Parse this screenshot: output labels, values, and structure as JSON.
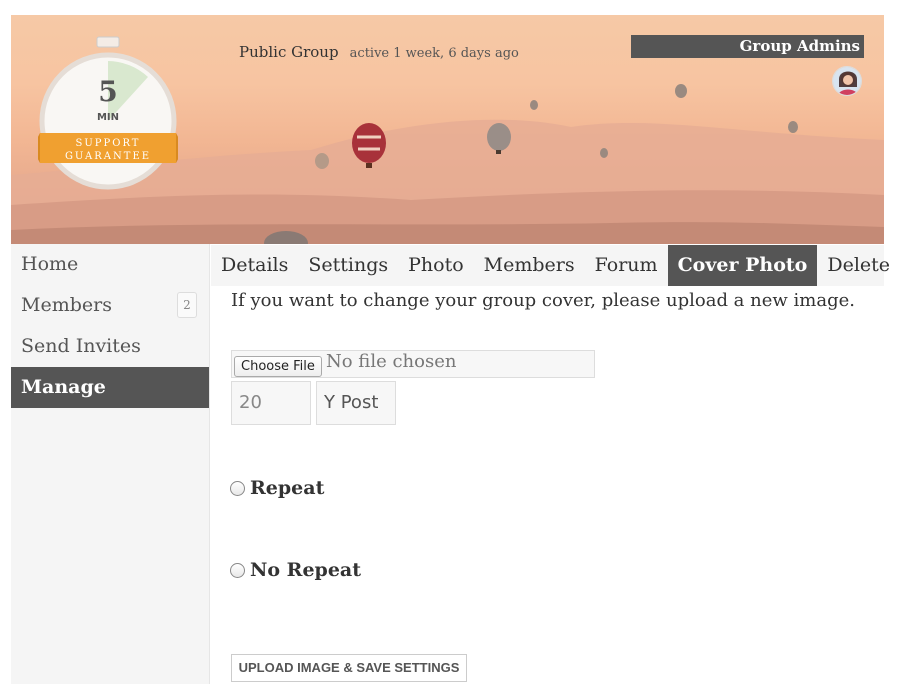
{
  "cover": {
    "badge": {
      "number": "5",
      "unit": "MIN",
      "ribbon_line1": "SUPPORT",
      "ribbon_line2": "GUARANTEE"
    },
    "group_type": "Public Group",
    "activity": "active 1 week, 6 days ago",
    "admins_title": "Group Admins"
  },
  "sidebar": {
    "items": [
      {
        "label": "Home"
      },
      {
        "label": "Members",
        "count": "2"
      },
      {
        "label": "Send Invites"
      },
      {
        "label": "Manage",
        "active": true
      }
    ]
  },
  "subnav": {
    "tabs": [
      {
        "label": "Details"
      },
      {
        "label": "Settings"
      },
      {
        "label": "Photo"
      },
      {
        "label": "Members"
      },
      {
        "label": "Forum"
      },
      {
        "label": "Cover Photo",
        "active": true
      },
      {
        "label": "Delete"
      }
    ]
  },
  "form": {
    "instructions": "If you want to change your group cover, please upload a new image.",
    "file_button": "Choose File",
    "file_status": "No file chosen",
    "position_value": "20",
    "position_axis": "Y Post",
    "repeat_label": "Repeat",
    "no_repeat_label": "No Repeat",
    "submit_label": "UPLOAD IMAGE & SAVE SETTINGS"
  },
  "colors": {
    "active_bg": "#555555",
    "sidebar_bg": "#f5f5f5",
    "badge_orange": "#f0a030"
  }
}
